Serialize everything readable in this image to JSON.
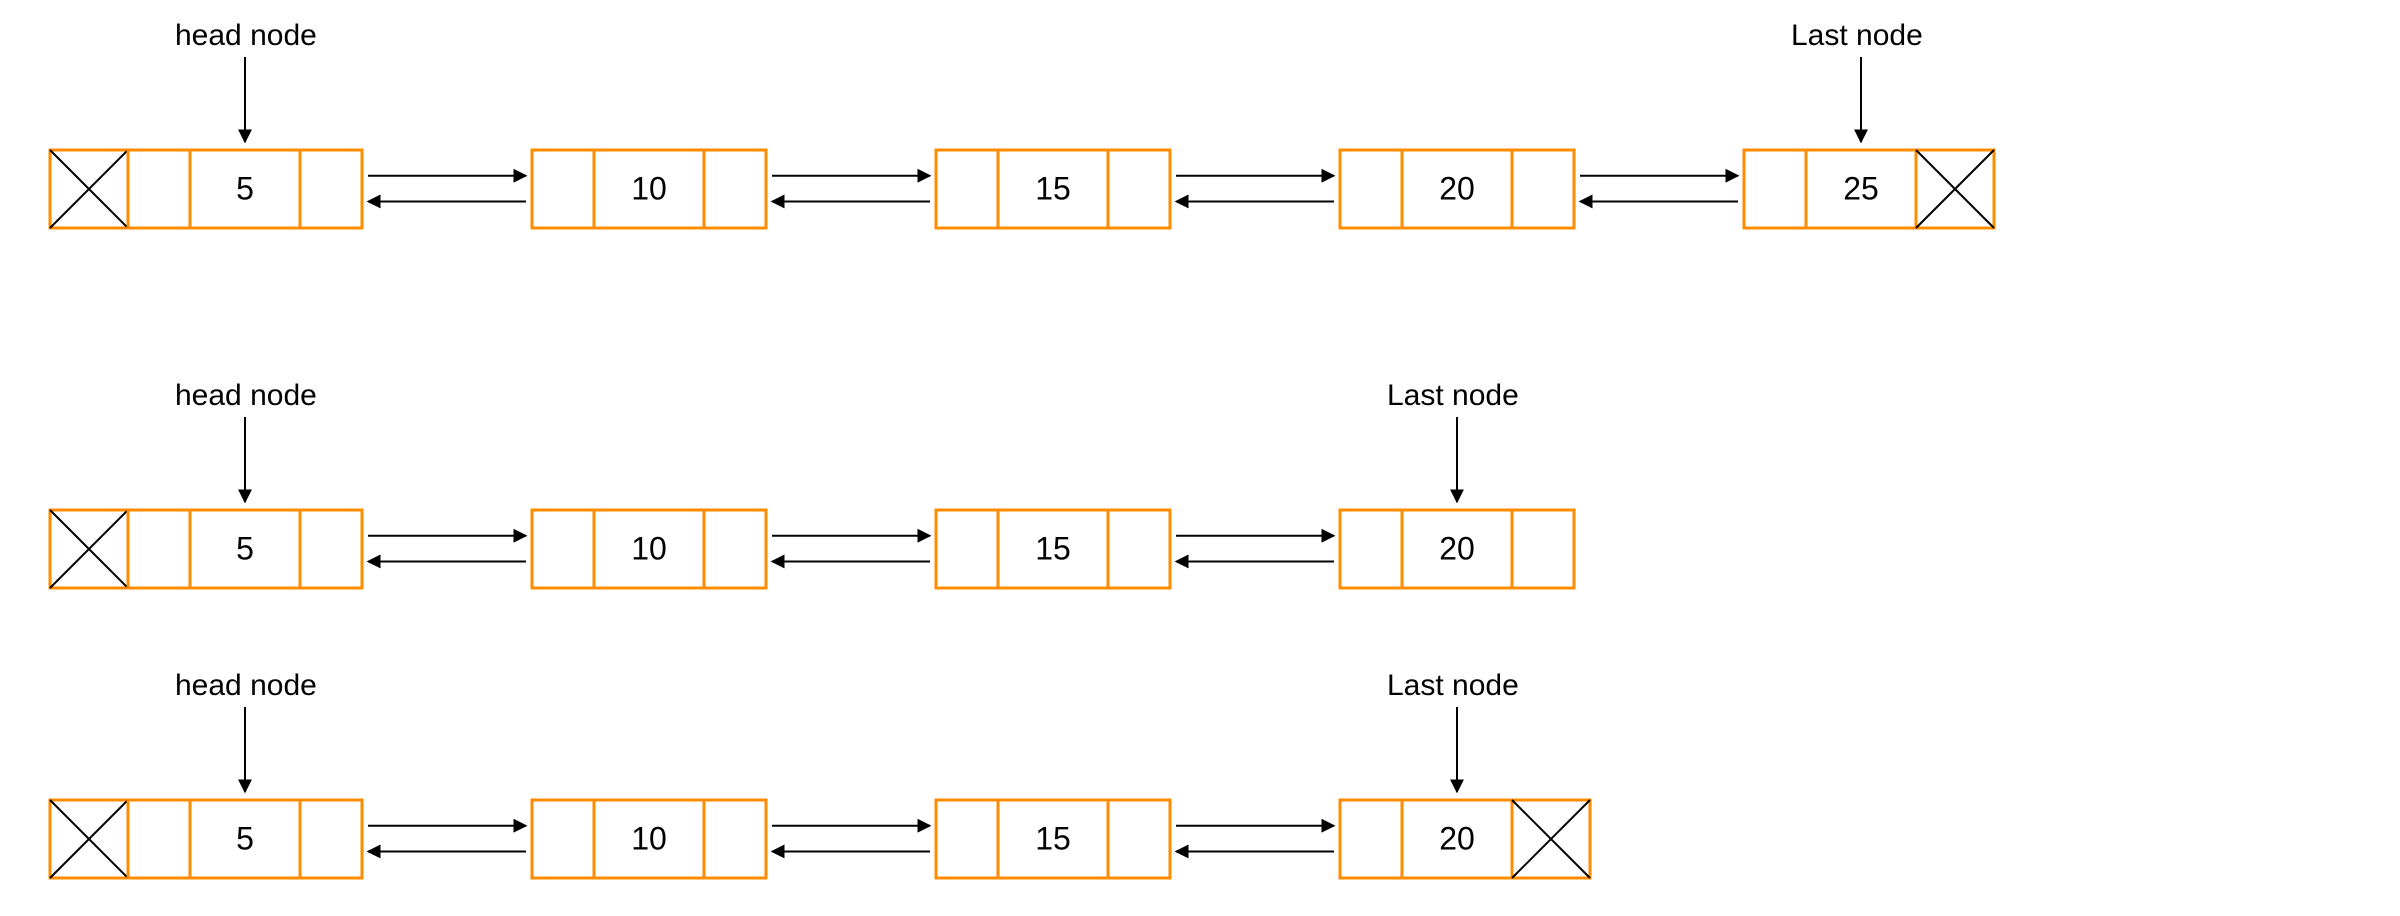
{
  "rows": [
    {
      "head_label": "head node",
      "last_label": "Last node",
      "head_null_box": true,
      "tail_null_box": true,
      "nodes": [
        {
          "value": "5",
          "prev": true,
          "next": true
        },
        {
          "value": "10",
          "prev": true,
          "next": true
        },
        {
          "value": "15",
          "prev": true,
          "next": true
        },
        {
          "value": "20",
          "prev": true,
          "next": true
        },
        {
          "value": "25",
          "prev": true,
          "next": false
        }
      ]
    },
    {
      "head_label": "head node",
      "last_label": "Last node",
      "head_null_box": true,
      "tail_null_box": false,
      "nodes": [
        {
          "value": "5",
          "prev": true,
          "next": true
        },
        {
          "value": "10",
          "prev": true,
          "next": true
        },
        {
          "value": "15",
          "prev": true,
          "next": true
        },
        {
          "value": "20",
          "prev": true,
          "next": true
        }
      ]
    },
    {
      "head_label": "head node",
      "last_label": "Last node",
      "head_null_box": true,
      "tail_null_box": true,
      "nodes": [
        {
          "value": "5",
          "prev": true,
          "next": true
        },
        {
          "value": "10",
          "prev": true,
          "next": true
        },
        {
          "value": "15",
          "prev": true,
          "next": true
        },
        {
          "value": "20",
          "prev": true,
          "next": false
        }
      ]
    }
  ]
}
